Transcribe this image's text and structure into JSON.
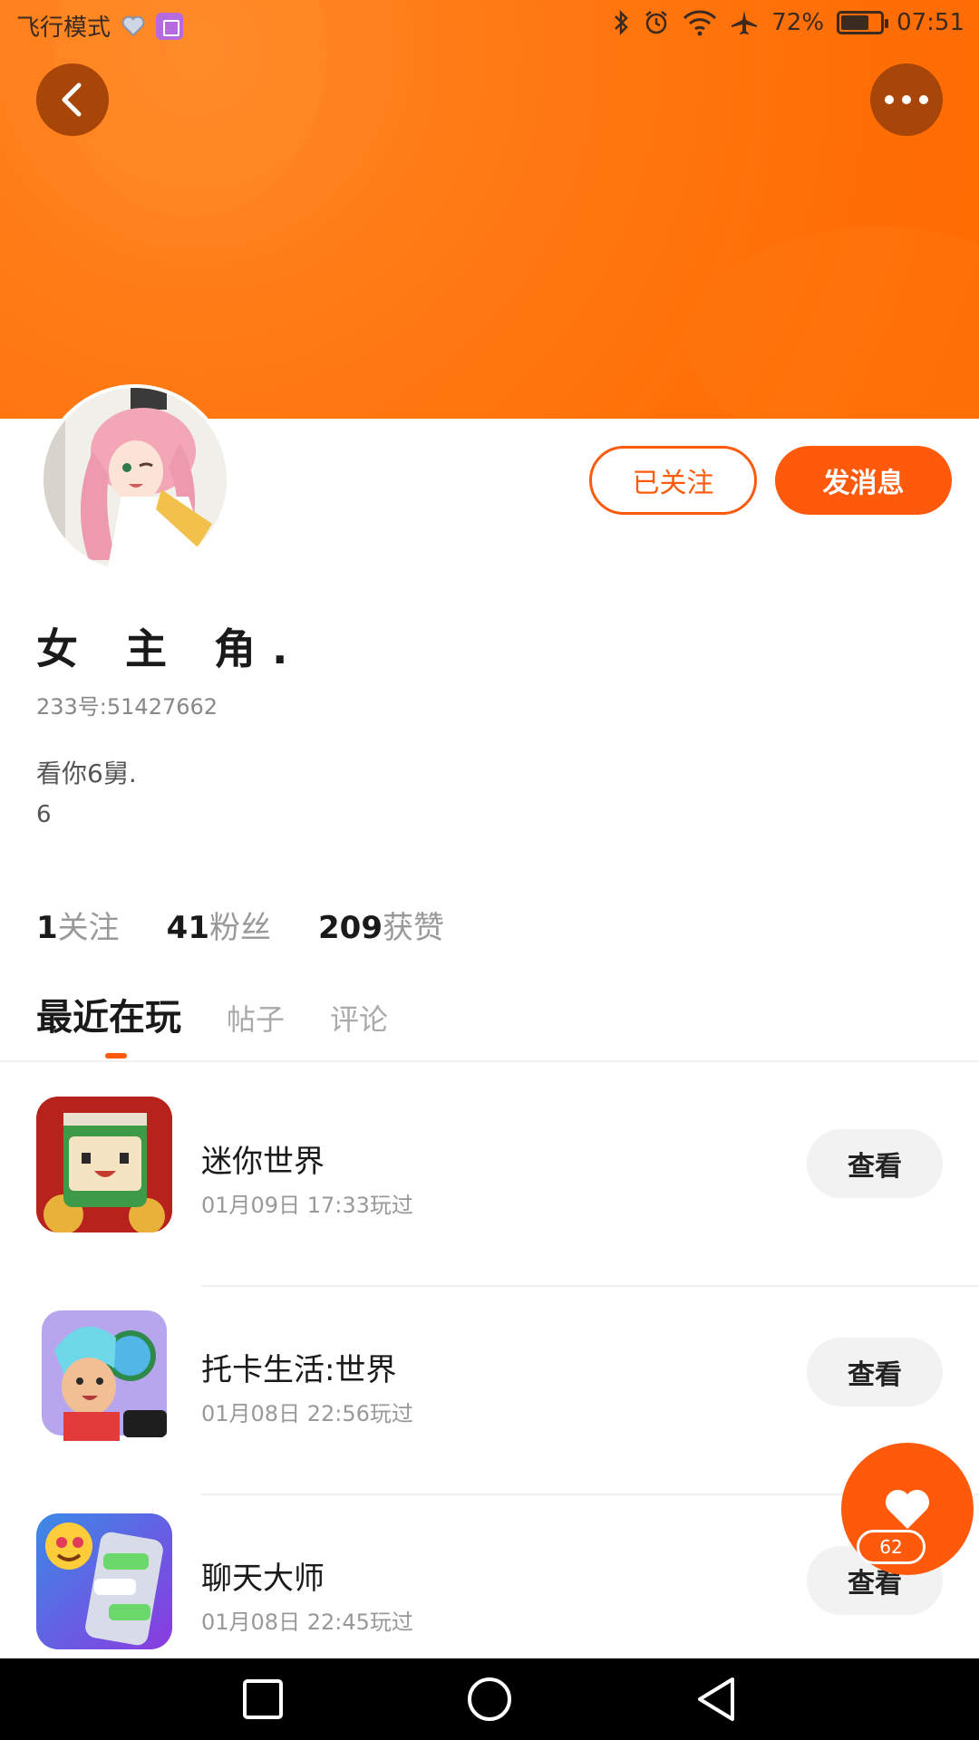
{
  "status_bar": {
    "mode_text": "飞行模式",
    "battery_text": "72%",
    "battery_level": 0.72,
    "time": "07:51"
  },
  "profile": {
    "follow_button_label": "已关注",
    "message_button_label": "发消息",
    "name": "女 主 角.",
    "id_text": "233号:51427662",
    "bio_line1": "看你6舅.",
    "bio_line2": "6"
  },
  "stats": [
    {
      "value": "1",
      "label": "关注"
    },
    {
      "value": "41",
      "label": "粉丝"
    },
    {
      "value": "209",
      "label": "获赞"
    }
  ],
  "tabs": [
    {
      "label": "最近在玩",
      "active": true
    },
    {
      "label": "帖子",
      "active": false
    },
    {
      "label": "评论",
      "active": false
    }
  ],
  "games": [
    {
      "name": "迷你世界",
      "time": "01月09日 17:33玩过",
      "button": "查看"
    },
    {
      "name": "托卡生活:世界",
      "time": "01月08日 22:56玩过",
      "button": "查看"
    },
    {
      "name": "聊天大师",
      "time": "01月08日 22:45玩过",
      "button": "查看"
    }
  ],
  "fab": {
    "count": "62"
  },
  "colors": {
    "accent": "#ff5a0c",
    "header": "#ff7a14"
  }
}
